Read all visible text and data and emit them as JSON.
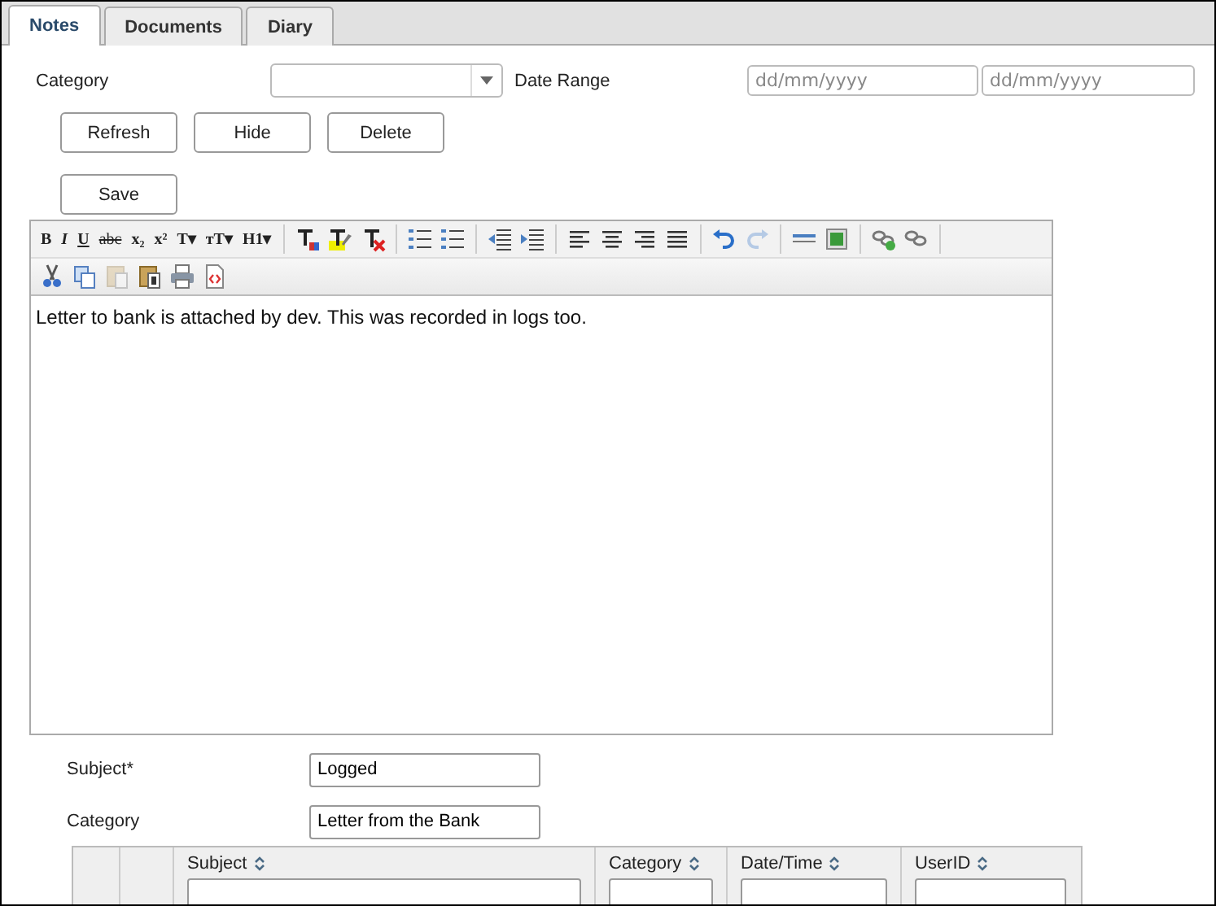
{
  "tabs": [
    {
      "label": "Notes",
      "selected": true
    },
    {
      "label": "Documents",
      "selected": false
    },
    {
      "label": "Diary",
      "selected": false
    }
  ],
  "filters": {
    "category_label": "Category",
    "date_range_label": "Date Range",
    "date_from": {
      "placeholder": "dd/mm/yyyy"
    },
    "date_to": {
      "placeholder": "dd/mm/yyyy"
    }
  },
  "buttons": [
    "Refresh",
    "Hide",
    "Delete"
  ],
  "save_button": "Save",
  "editor": {
    "toolbar_row_1": [
      {
        "kind": "glyph",
        "label": "B"
      },
      {
        "kind": "glyph",
        "label": "I"
      },
      {
        "kind": "glyph",
        "label": "U"
      },
      {
        "kind": "glyph",
        "label": "abc"
      },
      {
        "kind": "glyph",
        "label": "x₂"
      },
      {
        "kind": "glyph",
        "label": "x²"
      },
      {
        "kind": "glyph",
        "label": "T▾"
      },
      {
        "kind": "glyph",
        "label": "тT▾"
      },
      {
        "kind": "glyph",
        "label": "H1▾"
      },
      {
        "kind": "textcolor"
      },
      {
        "kind": "highlight"
      },
      {
        "kind": "clearformat"
      },
      {
        "kind": "bullets"
      },
      {
        "kind": "numbers"
      },
      {
        "kind": "outdent"
      },
      {
        "kind": "indent"
      },
      {
        "kind": "alignleft"
      },
      {
        "kind": "aligncenter"
      },
      {
        "kind": "alignright"
      },
      {
        "kind": "justify"
      },
      {
        "kind": "undo",
        "disabled": false
      },
      {
        "kind": "redo",
        "disabled": true
      },
      {
        "kind": "rule"
      },
      {
        "kind": "image"
      },
      {
        "kind": "link"
      },
      {
        "kind": "unlink"
      }
    ],
    "toolbar_row_2": [
      {
        "kind": "cut",
        "disabled": false
      },
      {
        "kind": "copy",
        "disabled": false
      },
      {
        "kind": "paste",
        "disabled": true
      },
      {
        "kind": "pastetext",
        "disabled": false
      },
      {
        "kind": "print",
        "disabled": false
      },
      {
        "kind": "source",
        "disabled": false
      }
    ],
    "content": "Letter to bank is attached by dev. This was recorded in logs too."
  },
  "subject": {
    "label": "Subject*",
    "value": "Logged"
  },
  "category": {
    "label": "Category",
    "value": "Letter from the Bank"
  },
  "table": {
    "columns": [
      "Subject",
      "Category",
      "Date/Time",
      "UserID"
    ]
  }
}
